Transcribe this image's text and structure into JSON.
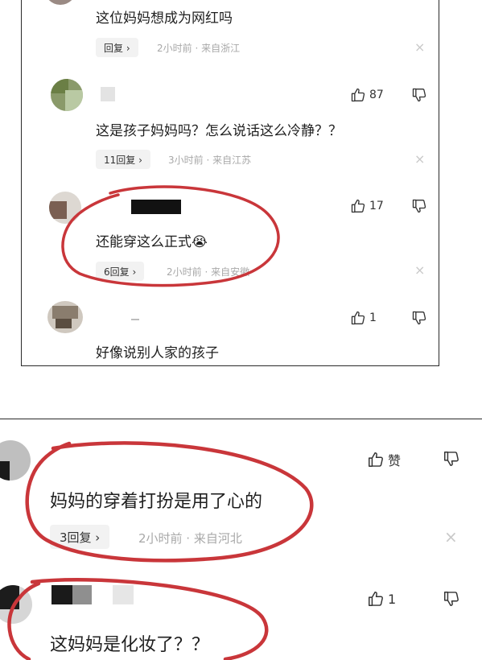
{
  "top_comments": [
    {
      "text": "这位妈妈想成为网红吗",
      "reply_label": "回复 ›",
      "meta": "2小时前 · 来自浙江",
      "close": "×"
    },
    {
      "likes": "87",
      "text": "这是孩子妈妈吗？怎么说话这么冷静？？",
      "reply_label": "11回复 ›",
      "meta": "3小时前 · 来自江苏",
      "close": "×"
    },
    {
      "likes": "17",
      "text": "还能穿这么正式",
      "emoji": "😭",
      "reply_label": "6回复 ›",
      "meta": "2小时前 · 来自安徽",
      "close": "×",
      "highlight_color": "#c9363a"
    },
    {
      "likes": "1",
      "text": "好像说别人家的孩子"
    }
  ],
  "bottom_comments": [
    {
      "likes": "赞",
      "text": "妈妈的穿着打扮是用了心的",
      "reply_label": "3回复 ›",
      "meta": "2小时前 · 来自河北",
      "close": "×",
      "highlight_color": "#c9363a"
    },
    {
      "likes": "1",
      "text": "这妈妈是化妆了？？",
      "highlight_color": "#c9363a"
    }
  ],
  "icons": {
    "like": "thumbs-up-icon",
    "dislike": "thumbs-down-icon",
    "close": "close-icon"
  }
}
